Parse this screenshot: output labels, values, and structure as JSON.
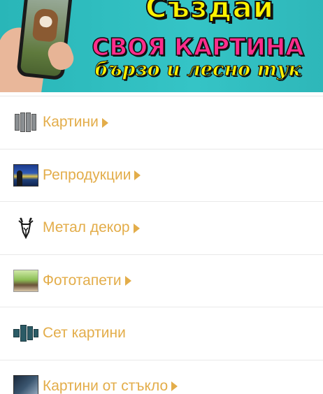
{
  "banner": {
    "line1": "Създай",
    "line2": "СВОЯ КАРТИНА",
    "line3": "бързо и лесно тук"
  },
  "menu": {
    "items": [
      {
        "label": "Картини",
        "icon": "paintings-icon",
        "has_arrow": true
      },
      {
        "label": "Репродукции",
        "icon": "reproduction-icon",
        "has_arrow": true
      },
      {
        "label": "Метал декор",
        "icon": "deer-head-icon",
        "has_arrow": true
      },
      {
        "label": "Фототапети",
        "icon": "photo-wallpaper-icon",
        "has_arrow": true
      },
      {
        "label": "Сет картини",
        "icon": "painting-set-icon",
        "has_arrow": false
      },
      {
        "label": "Картини от стъкло",
        "icon": "glass-painting-icon",
        "has_arrow": true
      }
    ],
    "label_color": "#e3ad4a"
  }
}
